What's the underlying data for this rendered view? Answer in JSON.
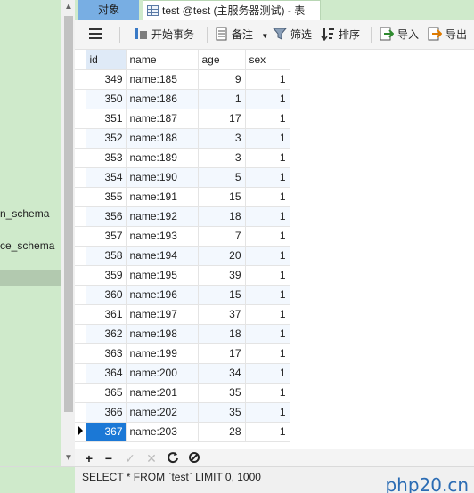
{
  "nav": {
    "items": [
      {
        "label": "n_schema",
        "selected": false
      },
      {
        "label": "ce_schema",
        "selected": false
      },
      {
        "label": "",
        "selected": true
      }
    ]
  },
  "tabs": [
    {
      "label": "对象",
      "active": false
    },
    {
      "label": "test @test (主服务器测试) - 表",
      "active": true
    }
  ],
  "toolbar": {
    "menu_icon": "hamburger-menu-icon",
    "begin_transaction": "开始事务",
    "note": "备注",
    "filter": "筛选",
    "sort": "排序",
    "import": "导入",
    "export": "导出"
  },
  "grid": {
    "columns": [
      "id",
      "name",
      "age",
      "sex"
    ],
    "rows": [
      {
        "id": "349",
        "name": "name:185",
        "age": "9",
        "sex": "1"
      },
      {
        "id": "350",
        "name": "name:186",
        "age": "1",
        "sex": "1"
      },
      {
        "id": "351",
        "name": "name:187",
        "age": "17",
        "sex": "1"
      },
      {
        "id": "352",
        "name": "name:188",
        "age": "3",
        "sex": "1"
      },
      {
        "id": "353",
        "name": "name:189",
        "age": "3",
        "sex": "1"
      },
      {
        "id": "354",
        "name": "name:190",
        "age": "5",
        "sex": "1"
      },
      {
        "id": "355",
        "name": "name:191",
        "age": "15",
        "sex": "1"
      },
      {
        "id": "356",
        "name": "name:192",
        "age": "18",
        "sex": "1"
      },
      {
        "id": "357",
        "name": "name:193",
        "age": "7",
        "sex": "1"
      },
      {
        "id": "358",
        "name": "name:194",
        "age": "20",
        "sex": "1"
      },
      {
        "id": "359",
        "name": "name:195",
        "age": "39",
        "sex": "1"
      },
      {
        "id": "360",
        "name": "name:196",
        "age": "15",
        "sex": "1"
      },
      {
        "id": "361",
        "name": "name:197",
        "age": "37",
        "sex": "1"
      },
      {
        "id": "362",
        "name": "name:198",
        "age": "18",
        "sex": "1"
      },
      {
        "id": "363",
        "name": "name:199",
        "age": "17",
        "sex": "1"
      },
      {
        "id": "364",
        "name": "name:200",
        "age": "34",
        "sex": "1"
      },
      {
        "id": "365",
        "name": "name:201",
        "age": "35",
        "sex": "1"
      },
      {
        "id": "366",
        "name": "name:202",
        "age": "35",
        "sex": "1"
      },
      {
        "id": "367",
        "name": "name:203",
        "age": "28",
        "sex": "1"
      }
    ],
    "current_row": 18
  },
  "actions": [
    "+",
    "−",
    "✓",
    "✕",
    "C",
    "⊘"
  ],
  "status": {
    "sql": "SELECT * FROM `test` LIMIT 0, 1000",
    "watermark": "php20.cn"
  },
  "colors": {
    "nav_bg": "#cfeacb",
    "active_tab_bg": "#78aee3",
    "selected_cell": "#1b78d6",
    "alt_row": "#f3f8fe"
  }
}
